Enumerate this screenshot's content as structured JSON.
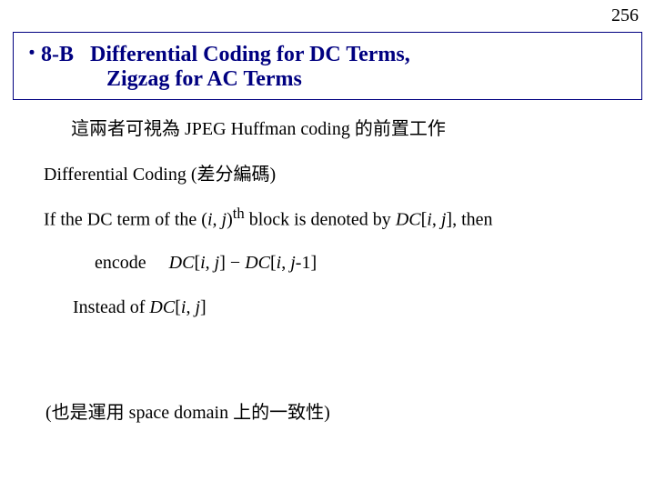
{
  "page_number": "256",
  "title": {
    "bullet": "・",
    "line1_section": "8-B",
    "line1_rest": "Differential Coding for DC Terms,",
    "line2": "Zigzag for AC Terms"
  },
  "intro": "這兩者可視為 JPEG Huffman coding 的前置工作",
  "diff_coding": {
    "label": "Differential Coding  (",
    "cjk": "差分編碼",
    "close": ")"
  },
  "if_line": {
    "p1": "If the DC term of the (",
    "ij": "i,  j",
    "p2": ")",
    "sup": "th",
    "p3": " block is denoted by ",
    "dc_open": "DC",
    "br_open": "[",
    "i": "i",
    "comma": ", ",
    "j": "j",
    "close": "], then"
  },
  "encode_line": {
    "word": "encode",
    "dc1": "DC",
    "open1": "[",
    "i1": "i",
    "c1": ", ",
    "j1": "j",
    "close1": "] ",
    "minus": "−",
    "sp": " ",
    "dc2": "DC",
    "open2": "[",
    "i2": "i",
    "c2": ", ",
    "j2": "j",
    "m1": "-1]"
  },
  "instead_line": {
    "p1": "Instead of   ",
    "dc": "DC",
    "open": "[",
    "i": "i",
    "c": ", ",
    "j": "j",
    "close": "]"
  },
  "footnote": "(也是運用 space domain 上的一致性)"
}
